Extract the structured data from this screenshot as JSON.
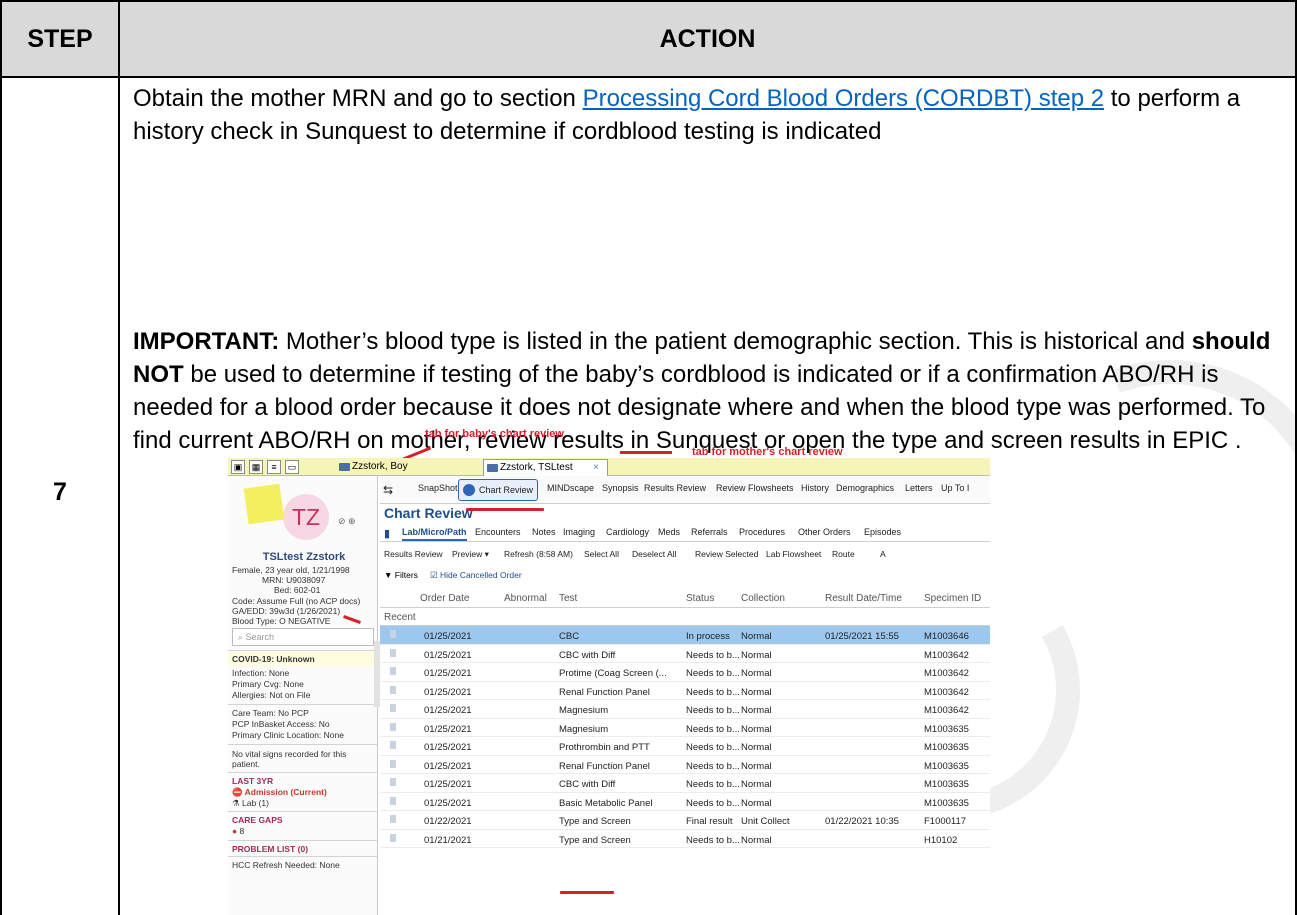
{
  "headers": {
    "step": "STEP",
    "action": "ACTION"
  },
  "step_number": "7",
  "para1": {
    "pre": "Obtain the mother MRN and go to section ",
    "link": "Processing Cord Blood Orders (CORDBT) step 2",
    "post": " to perform a history check in Sunquest to determine if cordblood testing is indicated"
  },
  "para2": {
    "important": "IMPORTANT:",
    "t1": " Mother’s blood type is listed in the patient demographic section. This is historical and ",
    "bold": "should NOT",
    "t2": " be used to determine if testing of the baby’s cordblood is indicated or if a confirmation ABO/RH is needed for a blood order because it does not designate where and when the blood type was performed. To find current ABO/RH on mother, review results in Sunquest or open the type and screen results in EPIC ."
  },
  "screenshot": {
    "annotations": {
      "baby": "tab for baby's chart review",
      "mother": "tab for mother's chart review"
    },
    "patient_tabs": {
      "boy": "Zzstork, Boy",
      "mother": "Zzstork, TSLtest",
      "close": "×"
    },
    "patient": {
      "initials": "TZ",
      "name": "TSLtest Zzstork",
      "line1": "Female, 23 year old, 1/21/1998",
      "mrn": "MRN: U9038097",
      "bed": "Bed: 602-01",
      "code": "Code: Assume Full (no ACP docs)",
      "ga": "GA/EDD: 39w3d (1/26/2021)",
      "blood": "Blood Type: O NEGATIVE",
      "search_placeholder": "Search",
      "covid": "COVID-19: Unknown",
      "infection": "Infection: None",
      "cvg": "Primary Cvg: None",
      "allergies": "Allergies: Not on File",
      "care_team": "Care Team: No PCP",
      "inbasket": "PCP InBasket Access: No",
      "clinic": "Primary Clinic Location: None",
      "vitals": "No vital signs recorded for this patient.",
      "last3yr": "LAST 3YR",
      "admission": "Admission (Current)",
      "lab": "Lab (1)",
      "care_gaps": "CARE GAPS",
      "gaps_count": "8",
      "problem": "PROBLEM LIST (0)",
      "hcc": "HCC Refresh Needed: None"
    },
    "activities": [
      "SnapShot",
      "Chart Review",
      "MINDscape",
      "Synopsis",
      "Results Review",
      "Review Flowsheets",
      "History",
      "Demographics",
      "Letters",
      "Up To I"
    ],
    "chart_review_title": "Chart Review",
    "subtabs": [
      "Lab/Micro/Path",
      "Encounters",
      "Notes",
      "Imaging",
      "Cardiology",
      "Meds",
      "Referrals",
      "Procedures",
      "Other Orders",
      "Episodes"
    ],
    "toolbar": [
      "Results Review",
      "Preview ▾",
      "Refresh (8:58 AM)",
      "Select All",
      "Deselect All",
      "Review Selected",
      "Lab Flowsheet",
      "Route",
      "A"
    ],
    "filters": {
      "label": "Filters",
      "hide": "Hide Cancelled Order"
    },
    "columns": [
      "Order Date",
      "Abnormal",
      "Test",
      "Status",
      "Collection",
      "Result Date/Time",
      "Specimen ID"
    ],
    "group": "Recent",
    "rows": [
      {
        "date": "01/25/2021",
        "test": "CBC",
        "status": "In process",
        "coll": "Normal",
        "result": "01/25/2021 15:55",
        "spec": "M1003646"
      },
      {
        "date": "01/25/2021",
        "test": "CBC with Diff",
        "status": "Needs to b...",
        "coll": "Normal",
        "result": "",
        "spec": "M1003642"
      },
      {
        "date": "01/25/2021",
        "test": "Protime (Coag Screen (...",
        "status": "Needs to b...",
        "coll": "Normal",
        "result": "",
        "spec": "M1003642"
      },
      {
        "date": "01/25/2021",
        "test": "Renal Function Panel",
        "status": "Needs to b...",
        "coll": "Normal",
        "result": "",
        "spec": "M1003642"
      },
      {
        "date": "01/25/2021",
        "test": "Magnesium",
        "status": "Needs to b...",
        "coll": "Normal",
        "result": "",
        "spec": "M1003642"
      },
      {
        "date": "01/25/2021",
        "test": "Magnesium",
        "status": "Needs to b...",
        "coll": "Normal",
        "result": "",
        "spec": "M1003635"
      },
      {
        "date": "01/25/2021",
        "test": "Prothrombin and PTT",
        "status": "Needs to b...",
        "coll": "Normal",
        "result": "",
        "spec": "M1003635"
      },
      {
        "date": "01/25/2021",
        "test": "Renal Function Panel",
        "status": "Needs to b...",
        "coll": "Normal",
        "result": "",
        "spec": "M1003635"
      },
      {
        "date": "01/25/2021",
        "test": "CBC with Diff",
        "status": "Needs to b...",
        "coll": "Normal",
        "result": "",
        "spec": "M1003635"
      },
      {
        "date": "01/25/2021",
        "test": "Basic Metabolic Panel",
        "status": "Needs to b...",
        "coll": "Normal",
        "result": "",
        "spec": "M1003635"
      },
      {
        "date": "01/22/2021",
        "test": "Type and Screen",
        "status": "Final result",
        "coll": "Unit Collect",
        "result": "01/22/2021 10:35",
        "spec": "F1000117"
      },
      {
        "date": "01/21/2021",
        "test": "Type and Screen",
        "status": "Needs to b...",
        "coll": "Normal",
        "result": "",
        "spec": "H10102"
      }
    ]
  }
}
